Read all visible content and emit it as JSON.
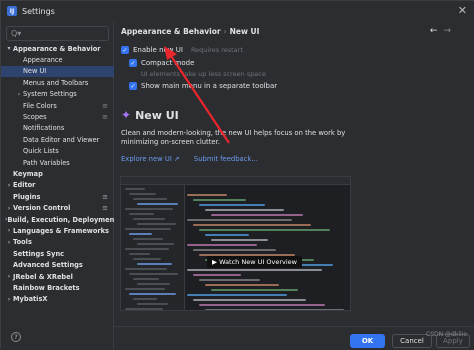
{
  "window": {
    "title": "Settings",
    "app_icon_letter": "IJ"
  },
  "search": {
    "placeholder": "Q▾"
  },
  "sidebar": {
    "items": [
      {
        "label": "Appearance & Behavior",
        "level": 0,
        "bold": true,
        "expanded": true
      },
      {
        "label": "Appearance",
        "level": 1
      },
      {
        "label": "New UI",
        "level": 1,
        "selected": true
      },
      {
        "label": "Menus and Toolbars",
        "level": 1
      },
      {
        "label": "System Settings",
        "level": 1,
        "expandable": true
      },
      {
        "label": "File Colors",
        "level": 1,
        "gear": true
      },
      {
        "label": "Scopes",
        "level": 1,
        "gear": true
      },
      {
        "label": "Notifications",
        "level": 1
      },
      {
        "label": "Data Editor and Viewer",
        "level": 1
      },
      {
        "label": "Quick Lists",
        "level": 1
      },
      {
        "label": "Path Variables",
        "level": 1
      },
      {
        "label": "Keymap",
        "level": 0,
        "bold": true
      },
      {
        "label": "Editor",
        "level": 0,
        "bold": true,
        "expandable": true
      },
      {
        "label": "Plugins",
        "level": 0,
        "bold": true,
        "gear": true
      },
      {
        "label": "Version Control",
        "level": 0,
        "bold": true,
        "expandable": true,
        "gear": true
      },
      {
        "label": "Build, Execution, Deployment",
        "level": 0,
        "bold": true,
        "expandable": true
      },
      {
        "label": "Languages & Frameworks",
        "level": 0,
        "bold": true,
        "expandable": true
      },
      {
        "label": "Tools",
        "level": 0,
        "bold": true,
        "expandable": true
      },
      {
        "label": "Settings Sync",
        "level": 0,
        "bold": true
      },
      {
        "label": "Advanced Settings",
        "level": 0,
        "bold": true
      },
      {
        "label": "JRebel & XRebel",
        "level": 0,
        "bold": true,
        "expandable": true
      },
      {
        "label": "Rainbow Brackets",
        "level": 0,
        "bold": true
      },
      {
        "label": "MybatisX",
        "level": 0,
        "bold": true,
        "expandable": true
      }
    ]
  },
  "breadcrumb": {
    "parent": "Appearance & Behavior",
    "separator": "›",
    "current": "New UI"
  },
  "options": {
    "enable_new_ui": {
      "label": "Enable new UI",
      "hint": "Requires restart"
    },
    "compact_mode": {
      "label": "Compact mode",
      "hint": "UI elements take up less screen space"
    },
    "main_menu_toolbar": {
      "label": "Show main menu in a separate toolbar"
    }
  },
  "section": {
    "title": "New UI",
    "description": "Clean and modern-looking, the new UI helps focus on the work by minimizing on-screen clutter.",
    "explore_link": "Explore new UI ↗",
    "feedback_link": "Submit feedback..."
  },
  "preview": {
    "watch_label": "▶ Watch New UI Overview"
  },
  "footer": {
    "ok": "OK",
    "cancel": "Cancel",
    "apply": "Apply"
  },
  "watermark": "CSDN @dkliio",
  "colors": {
    "accent": "#3574f0",
    "selection": "#2e436e",
    "link": "#6d9cf2",
    "annotation": "#e8262c"
  }
}
